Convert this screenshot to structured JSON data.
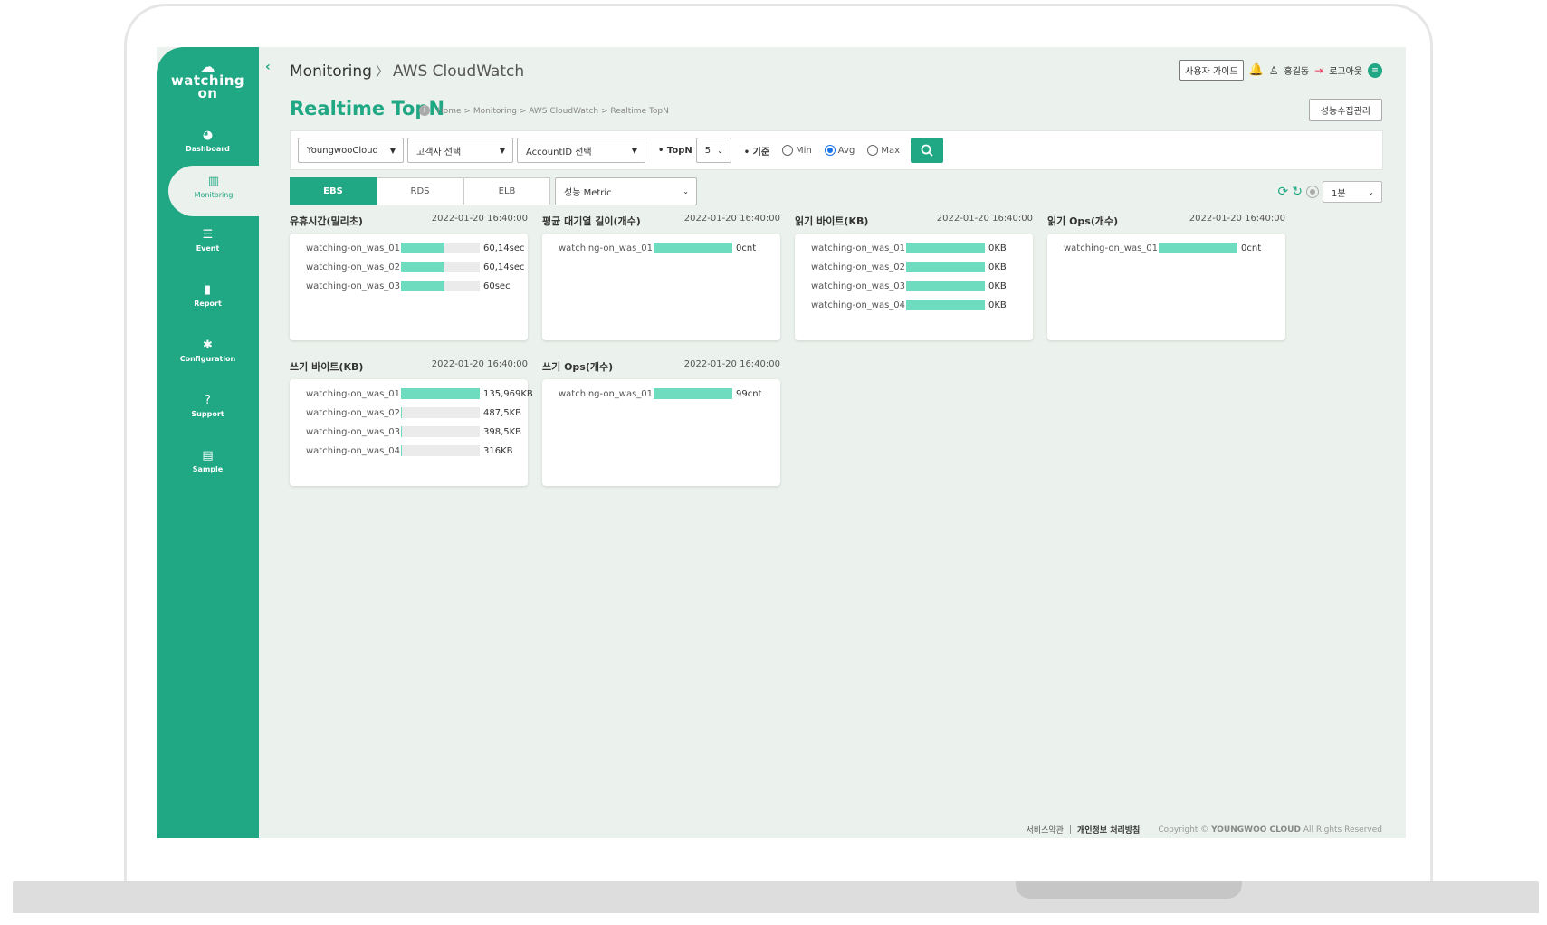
{
  "app": {
    "logo_top": "☁",
    "logo_line1": "watching",
    "logo_line2": "on"
  },
  "sidebar": {
    "items": [
      {
        "label": "Dashboard",
        "icon": "gauge-icon",
        "glyph": "◕"
      },
      {
        "label": "Monitoring",
        "icon": "chart-icon",
        "glyph": "▥"
      },
      {
        "label": "Event",
        "icon": "list-icon",
        "glyph": "☰"
      },
      {
        "label": "Report",
        "icon": "clipboard-icon",
        "glyph": "▮"
      },
      {
        "label": "Configuration",
        "icon": "gear-icon",
        "glyph": "✱"
      },
      {
        "label": "Support",
        "icon": "question-icon",
        "glyph": "?"
      },
      {
        "label": "Sample",
        "icon": "file-icon",
        "glyph": "▤"
      }
    ]
  },
  "header": {
    "collapse": "‹",
    "title_main": "Monitoring",
    "title_sep": "〉",
    "title_sub": "AWS CloudWatch",
    "guide_label": "사용자 가이드",
    "user_name": "홍길동",
    "logout_label": "로그아웃",
    "bell_glyph": "🔔",
    "user_glyph": "♙",
    "logout_glyph": "⇥",
    "menu_glyph": "≡"
  },
  "page": {
    "title": "Realtime TopN",
    "info": "i",
    "breadcrumb": "Home > Monitoring > AWS CloudWatch > Realtime TopN",
    "perf_button": "성능수집관리"
  },
  "filters": {
    "cloud": "YoungwooCloud",
    "customer": "고객사 선택",
    "account": "AccountID 선택",
    "topn_label": "• TopN",
    "topn_value": "5",
    "basis_label": "• 기준",
    "radio_min": "Min",
    "radio_avg": "Avg",
    "radio_max": "Max",
    "selected_basis": "Avg"
  },
  "tabs": {
    "ebs": "EBS",
    "rds": "RDS",
    "elb": "ELB",
    "active": "EBS",
    "metric": "성능 Metric",
    "interval": "1분"
  },
  "cards": [
    {
      "title": "유휴시간(밀리초)",
      "timestamp": "2022-01-20 16:40:00",
      "rows": [
        {
          "name": "watching-on_was_01",
          "fraction": 0.55,
          "value": "60,14sec"
        },
        {
          "name": "watching-on_was_02",
          "fraction": 0.55,
          "value": "60,14sec"
        },
        {
          "name": "watching-on_was_03",
          "fraction": 0.55,
          "value": "60sec"
        }
      ]
    },
    {
      "title": "평균 대기열 길이(개수)",
      "timestamp": "2022-01-20 16:40:00",
      "rows": [
        {
          "name": "watching-on_was_01",
          "fraction": 1.0,
          "value": "0cnt"
        }
      ]
    },
    {
      "title": "읽기 바이트(KB)",
      "timestamp": "2022-01-20 16:40:00",
      "rows": [
        {
          "name": "watching-on_was_01",
          "fraction": 1.0,
          "value": "0KB"
        },
        {
          "name": "watching-on_was_02",
          "fraction": 1.0,
          "value": "0KB"
        },
        {
          "name": "watching-on_was_03",
          "fraction": 1.0,
          "value": "0KB"
        },
        {
          "name": "watching-on_was_04",
          "fraction": 1.0,
          "value": "0KB"
        }
      ]
    },
    {
      "title": "읽기 Ops(개수)",
      "timestamp": "2022-01-20 16:40:00",
      "rows": [
        {
          "name": "watching-on_was_01",
          "fraction": 1.0,
          "value": "0cnt"
        }
      ]
    },
    {
      "title": "쓰기 바이트(KB)",
      "timestamp": "2022-01-20 16:40:00",
      "rows": [
        {
          "name": "watching-on_was_01",
          "fraction": 1.0,
          "value": "135,969KB"
        },
        {
          "name": "watching-on_was_02",
          "fraction": 0.01,
          "value": "487,5KB"
        },
        {
          "name": "watching-on_was_03",
          "fraction": 0.01,
          "value": "398,5KB"
        },
        {
          "name": "watching-on_was_04",
          "fraction": 0.01,
          "value": "316KB"
        }
      ]
    },
    {
      "title": "쓰기 Ops(개수)",
      "timestamp": "2022-01-20 16:40:00",
      "rows": [
        {
          "name": "watching-on_was_01",
          "fraction": 1.0,
          "value": "99cnt"
        }
      ]
    }
  ],
  "footer": {
    "terms": "서비스약관",
    "divider": "|",
    "privacy": "개인정보 처리방침",
    "copyright_prefix": "Copyright ©",
    "copyright_company": "YOUNGWOO CLOUD",
    "copyright_suffix": "All Rights Reserved"
  },
  "colors": {
    "brand": "#20a783",
    "bar": "#6edcbf",
    "background": "#ebf1ec"
  }
}
